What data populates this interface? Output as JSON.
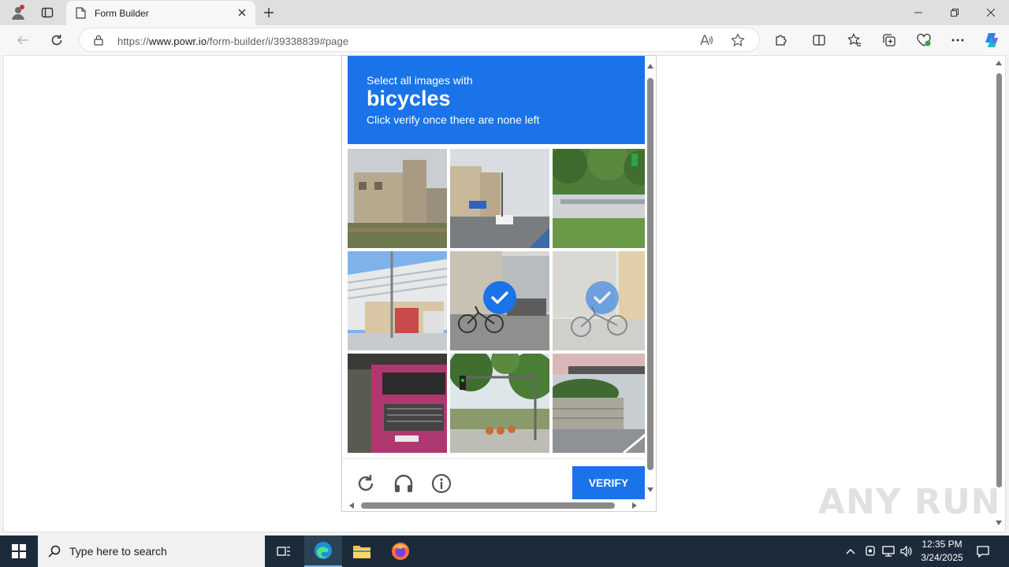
{
  "browser": {
    "tab_title": "Form Builder",
    "url_prefix": "https://",
    "url_host": "www.powr.io",
    "url_path": "/form-builder/i/39338839#page"
  },
  "captcha": {
    "instruction": "Select all images with",
    "target_word": "bicycles",
    "note": "Click verify once there are none left",
    "verify_label": "VERIFY",
    "tiles": [
      {
        "selected": false
      },
      {
        "selected": false
      },
      {
        "selected": false
      },
      {
        "selected": false
      },
      {
        "selected": true
      },
      {
        "selected": true
      },
      {
        "selected": false
      },
      {
        "selected": false
      },
      {
        "selected": false
      }
    ],
    "accent_color": "#1a73e8"
  },
  "taskbar": {
    "search_placeholder": "Type here to search",
    "time": "12:35 PM",
    "date": "3/24/2025"
  },
  "watermark": "ANY RUN"
}
